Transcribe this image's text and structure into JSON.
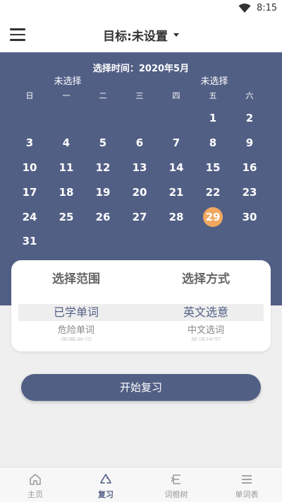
{
  "status_bar": {
    "time": "8:15",
    "wifi_icon": "wifi-icon"
  },
  "app_bar": {
    "title": "目标:未设置",
    "menu_icon": "menu-icon",
    "dropdown_icon": "caret-down-icon"
  },
  "calendar": {
    "header": "选择时间：2020年5月",
    "selection_labels": [
      {
        "text": "未选择",
        "weekday_index": 1
      },
      {
        "text": "未选择",
        "weekday_index": 5
      }
    ],
    "weekdays": [
      "日",
      "一",
      "二",
      "三",
      "四",
      "五",
      "六"
    ],
    "weeks": [
      [
        "",
        "",
        "",
        "",
        "",
        "1",
        "2"
      ],
      [
        "3",
        "4",
        "5",
        "6",
        "7",
        "8",
        "9"
      ],
      [
        "10",
        "11",
        "12",
        "13",
        "14",
        "15",
        "16"
      ],
      [
        "17",
        "18",
        "19",
        "20",
        "21",
        "22",
        "23"
      ],
      [
        "24",
        "25",
        "26",
        "27",
        "28",
        "29",
        "30"
      ],
      [
        "31",
        "",
        "",
        "",
        "",
        "",
        ""
      ]
    ],
    "today": "29",
    "today_color": "#f0a860",
    "panel_color": "#525f85"
  },
  "picker": {
    "columns": [
      {
        "title": "选择范围",
        "selected": "已学单词",
        "next": "危险单词",
        "faint": "需要单词"
      },
      {
        "title": "选择方式",
        "selected": "英文选意",
        "next": "中文选词",
        "faint": "英语拼写"
      }
    ]
  },
  "start_button": {
    "label": "开始复习"
  },
  "bottom_nav": {
    "items": [
      {
        "label": "主页",
        "icon": "home-icon",
        "active": false
      },
      {
        "label": "复习",
        "icon": "recycle-icon",
        "active": true
      },
      {
        "label": "词根树",
        "icon": "tree-icon",
        "active": false
      },
      {
        "label": "单词表",
        "icon": "list-icon",
        "active": false
      }
    ]
  }
}
